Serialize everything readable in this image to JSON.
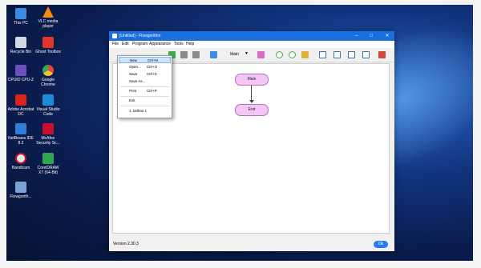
{
  "desktop": {
    "icons": [
      {
        "label": "This PC",
        "icon": "this-pc-icon",
        "color": "#3d8be0"
      },
      {
        "label": "VLC media player",
        "icon": "vlc-icon",
        "color": "#f08a10"
      },
      {
        "label": "Recycle Bin",
        "icon": "recycle-bin-icon",
        "color": "#cfd8e3"
      },
      {
        "label": "Ghost Toolbox",
        "icon": "ghost-toolbox-icon",
        "color": "#e0362a"
      },
      {
        "label": "CPUID CPU-Z",
        "icon": "cpuz-icon",
        "color": "#6a4fc2"
      },
      {
        "label": "Google Chrome",
        "icon": "chrome-icon",
        "color": "#f2c230"
      },
      {
        "label": "Adobe Acrobat DC",
        "icon": "acrobat-icon",
        "color": "#d9241d"
      },
      {
        "label": "Visual Studio Code",
        "icon": "vscode-icon",
        "color": "#1f8ad7"
      },
      {
        "label": "NetBeans IDE 8.2",
        "icon": "netbeans-icon",
        "color": "#2f7ed8"
      },
      {
        "label": "McAfee Security Sc...",
        "icon": "mcafee-icon",
        "color": "#c8102e"
      },
      {
        "label": "Bandicam",
        "icon": "bandicam-icon",
        "color": "#e5e5e5"
      },
      {
        "label": "CorelDRAW X7 (64-Bit)",
        "icon": "coreldraw-icon",
        "color": "#2fa84f"
      },
      {
        "label": "Flowgorith...",
        "icon": "flowgorithm-icon",
        "color": "#7aa3d8"
      }
    ]
  },
  "window": {
    "title": "[Untitled] - Flowgorithm",
    "minimize": "–",
    "maximize": "□",
    "close": "✕",
    "menu": [
      "File",
      "Edit",
      "Program",
      "Appearance",
      "Tools",
      "Help"
    ],
    "toolbar_dropdown": "Main",
    "file_menu": [
      {
        "label": "New",
        "shortcut": "Ctrl+N"
      },
      {
        "label": "Open...",
        "shortcut": "Ctrl+O"
      },
      {
        "label": "Save",
        "shortcut": "Ctrl+S"
      },
      {
        "label": "Save As...",
        "shortcut": ""
      },
      {
        "label": "Print",
        "shortcut": "Ctrl+P"
      },
      {
        "label": "Exit",
        "shortcut": ""
      },
      {
        "label": "1. latihan 1",
        "shortcut": ""
      }
    ],
    "flowchart": {
      "start": "Main",
      "end": "End"
    },
    "version": "Version 2.30.3",
    "ok_label": "Ok"
  }
}
